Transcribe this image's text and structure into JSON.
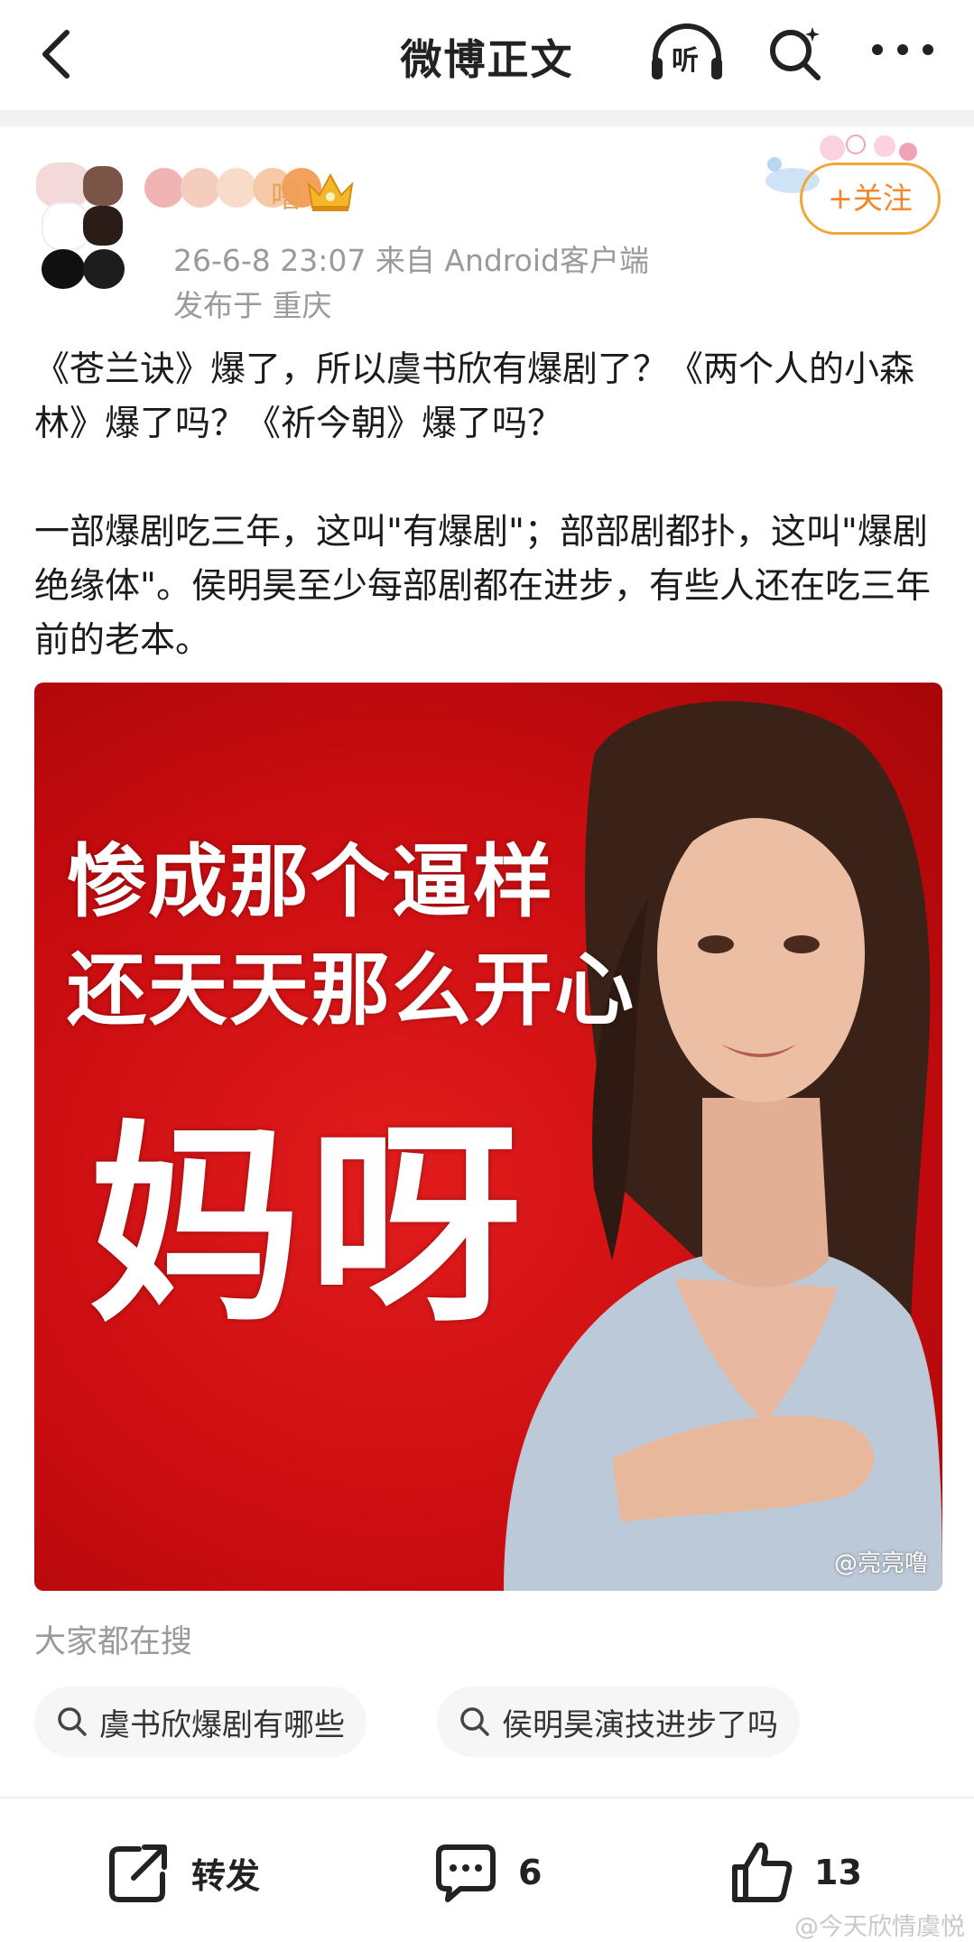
{
  "header": {
    "title": "微博正文",
    "listen_label": "听"
  },
  "author": {
    "name_tail": "噜",
    "timestamp_source": "26-6-8 23:07  来自 Android客户端",
    "location": "发布于 重庆",
    "follow_label": "+关注"
  },
  "post": {
    "paragraphs": [
      "《苍兰诀》爆了，所以虞书欣有爆剧了？《两个人的小森林》爆了吗？《祈今朝》爆了吗？",
      "一部爆剧吃三年，这叫\"有爆剧\"；部部剧都扑，这叫\"爆剧绝缘体\"。侯明昊至少每部剧都在进步，有些人还在吃三年前的老本。"
    ],
    "image": {
      "line1": "惨成那个逼样",
      "line2": "还天天那么开心",
      "line3": "妈呀",
      "watermark": "@亮亮噜"
    }
  },
  "trending": {
    "title": "大家都在搜",
    "items": [
      "虞书欣爆剧有哪些",
      "侯明昊演技进步了吗"
    ]
  },
  "actions": {
    "repost_label": "转发",
    "comment_count": "6",
    "like_count": "13"
  },
  "footer": {
    "watermark": "@今天欣情虞悦"
  },
  "colors": {
    "accent_orange": "#f3862a",
    "meta_gray": "#9a9a9a",
    "image_red": "#d4141a"
  }
}
